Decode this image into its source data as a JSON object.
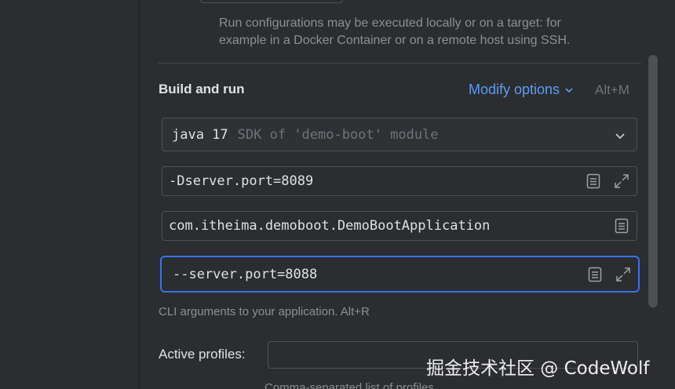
{
  "run_config": {
    "hint_line1": "Run configurations may be executed locally or on a target: for",
    "hint_line2": "example in a Docker Container or on a remote host using SSH."
  },
  "build_and_run": {
    "title": "Build and run",
    "modify_options_label": "Modify options",
    "modify_options_shortcut": "Alt+M",
    "sdk": {
      "name": "java 17",
      "hint": "SDK of 'demo-boot' module"
    },
    "vm_options": {
      "value": "-Dserver.port=8089"
    },
    "main_class": {
      "value": "com.itheima.demoboot.DemoBootApplication"
    },
    "program_arguments": {
      "value": "--server.port=8088",
      "hint": "CLI arguments to your application. Alt+R"
    }
  },
  "active_profiles": {
    "label": "Active profiles:",
    "value": "",
    "hint": "Comma-separated list of profiles"
  },
  "watermark": "掘金技术社区 @ CodeWolf",
  "colors": {
    "accent": "#3574f0",
    "link": "#5c9cf5",
    "background": "#2b2d30"
  },
  "icons": [
    "chevron-down-icon",
    "document-icon",
    "expand-icon"
  ]
}
